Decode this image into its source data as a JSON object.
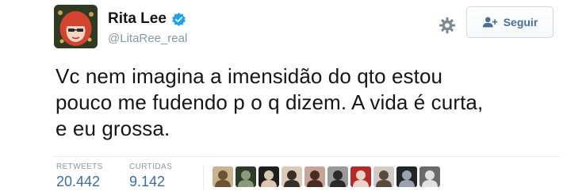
{
  "author": {
    "display_name": "Rita Lee",
    "username": "@LitaRee_real",
    "verified": true,
    "avatar_icon": "profile-avatar"
  },
  "actions": {
    "settings_icon": "gear-icon",
    "follow_label": "Seguir",
    "follow_icon": "add-user-icon"
  },
  "tweet": {
    "lines": [
      "Vc nem imagina a imensidão do qto estou",
      "pouco me fudendo p o q dizem. A vida é curta,",
      "e eu grossa."
    ]
  },
  "stats": {
    "retweets_label": "RETWEETS",
    "retweets_value": "20.442",
    "likes_label": "CURTIDAS",
    "likes_value": "9.142"
  },
  "likers": [
    {
      "name": "liker-avatar-1",
      "bg": "#c9b38f",
      "fg": "#6b5433"
    },
    {
      "name": "liker-avatar-2",
      "bg": "#2f3b2a",
      "fg": "#8a9a7a"
    },
    {
      "name": "liker-avatar-3",
      "bg": "#1e1e1e",
      "fg": "#d8c8b0"
    },
    {
      "name": "liker-avatar-4",
      "bg": "#d9cbb8",
      "fg": "#3a2f28"
    },
    {
      "name": "liker-avatar-5",
      "bg": "#c7a496",
      "fg": "#4a2c24"
    },
    {
      "name": "liker-avatar-6",
      "bg": "#9a9a9a",
      "fg": "#2a2a2a"
    },
    {
      "name": "liker-avatar-7",
      "bg": "#b32a2a",
      "fg": "#e8d4c4"
    },
    {
      "name": "liker-avatar-8",
      "bg": "#d0cbc4",
      "fg": "#5a4a3e"
    },
    {
      "name": "liker-avatar-9",
      "bg": "#222428",
      "fg": "#9aa2b0"
    },
    {
      "name": "liker-avatar-10",
      "bg": "#6a6a6a",
      "fg": "#e0e0e0"
    }
  ],
  "colors": {
    "link_blue": "#3b6ea5",
    "muted": "#8899a6",
    "verified_blue": "#1da1f2"
  }
}
